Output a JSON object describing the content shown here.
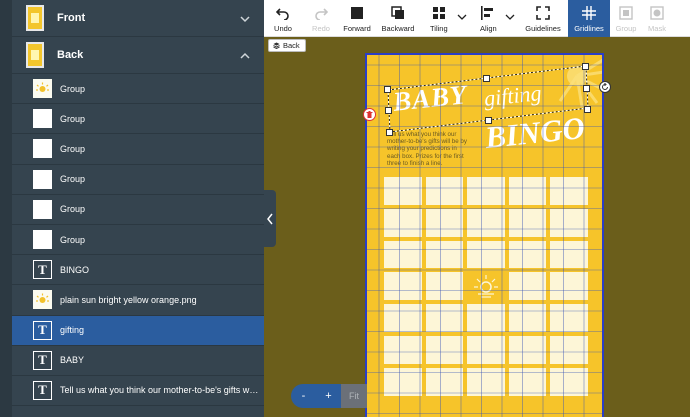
{
  "layers": {
    "front": {
      "label": "Front"
    },
    "back": {
      "label": "Back"
    },
    "items": [
      {
        "label": "Group",
        "type": "image"
      },
      {
        "label": "Group",
        "type": "blank"
      },
      {
        "label": "Group",
        "type": "blank"
      },
      {
        "label": "Group",
        "type": "blank"
      },
      {
        "label": "Group",
        "type": "blank"
      },
      {
        "label": "Group",
        "type": "blank"
      },
      {
        "label": "BINGO",
        "type": "text",
        "glyph": "T"
      },
      {
        "label": "plain sun bright yellow orange.png",
        "type": "image"
      },
      {
        "label": "gifting",
        "type": "text",
        "glyph": "T",
        "selected": true
      },
      {
        "label": "BABY",
        "type": "text",
        "glyph": "T"
      },
      {
        "label": "Tell us what you think our mother-to-be's gifts will...",
        "type": "text",
        "glyph": "T"
      }
    ]
  },
  "toolbar": {
    "undo": "Undo",
    "redo": "Redo",
    "forward": "Forward",
    "backward": "Backward",
    "tiling": "Tiling",
    "align": "Align",
    "guidelines": "Guidelines",
    "gridlines": "Gridlines",
    "group": "Group",
    "mask": "Mask"
  },
  "back_button": "Back",
  "canvas": {
    "title_baby": "BABY",
    "title_gifting": "gifting",
    "title_bingo": "BINGO",
    "instructions": "Tell us what you think our mother-to-be's gifts will be by writing your predictions in each box. Prizes for the first three to finish a line."
  },
  "zoom": {
    "minus": "-",
    "plus": "+",
    "fit": "Fit"
  },
  "colors": {
    "panel": "#35444f",
    "selected": "#2b5d9f",
    "card": "#f6c42a",
    "canvas_bg": "#6b5e1b"
  }
}
